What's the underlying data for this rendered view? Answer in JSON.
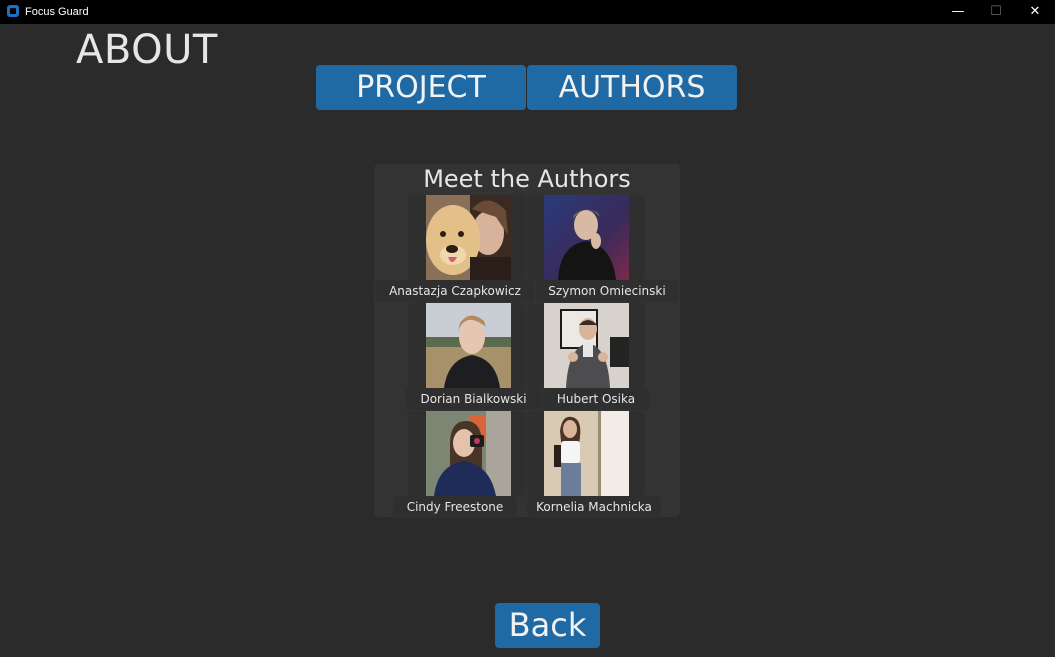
{
  "window": {
    "title": "Focus Guard",
    "minimize_glyph": "—",
    "maximize_glyph": "☐",
    "close_glyph": "✕"
  },
  "page": {
    "title": "ABOUT"
  },
  "tabs": [
    {
      "label": "PROJECT",
      "selected": false
    },
    {
      "label": "AUTHORS",
      "selected": true
    }
  ],
  "authors_section": {
    "title": "Meet the Authors",
    "authors": [
      {
        "name": "Anastazja Czapkowicz",
        "photo": "portrait-with-dog"
      },
      {
        "name": "Szymon Omiecinski",
        "photo": "portrait-dark-background"
      },
      {
        "name": "Dorian Bialkowski",
        "photo": "portrait-outdoors-field"
      },
      {
        "name": "Hubert Osika",
        "photo": "portrait-thumbs-up"
      },
      {
        "name": "Cindy Freestone",
        "photo": "portrait-mirror-selfie"
      },
      {
        "name": "Kornelia Machnicka",
        "photo": "portrait-full-body-mirror"
      }
    ]
  },
  "back_button": {
    "label": "Back"
  },
  "colors": {
    "background": "#2b2b2b",
    "accent": "#1f6aa5",
    "title_bar": "#000000",
    "text": "#e6e6e6"
  }
}
